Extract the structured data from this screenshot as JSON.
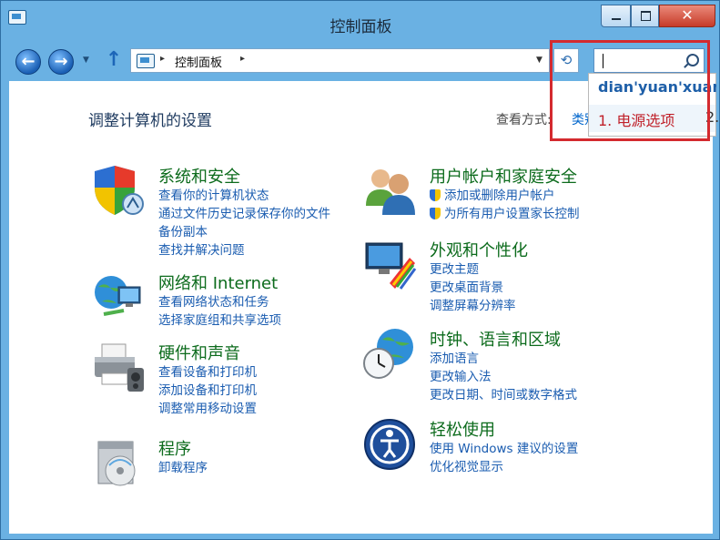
{
  "window": {
    "title": "控制面板",
    "close_glyph": "✕"
  },
  "nav": {
    "back_glyph": "←",
    "forward_glyph": "→",
    "up_glyph": "↑",
    "dropdown_glyph": "▼",
    "refresh_glyph": "⟲"
  },
  "address": {
    "path": [
      "控制面板"
    ],
    "sep_glyph": "▸"
  },
  "search": {
    "value": ""
  },
  "ime": {
    "composition": "dian'yuan'xuan",
    "candidate": "1. 电源选项",
    "next": "2."
  },
  "page": {
    "title": "调整计算机的设置",
    "view_by_label": "查看方式:",
    "view_by_value": "类别"
  },
  "categories": [
    {
      "title": "系统和安全",
      "links": [
        "查看你的计算机状态",
        "通过文件历史记录保存你的文件",
        "备份副本",
        "查找并解决问题"
      ],
      "icon": "shield-icon"
    },
    {
      "title": "网络和 Internet",
      "links": [
        "查看网络状态和任务",
        "选择家庭组和共享选项"
      ],
      "icon": "network-icon"
    },
    {
      "title": "硬件和声音",
      "links": [
        "查看设备和打印机",
        "添加设备和打印机",
        "调整常用移动设置"
      ],
      "icon": "printer-icon"
    },
    {
      "title": "程序",
      "links": [
        "卸载程序"
      ],
      "icon": "programs-icon"
    },
    {
      "title": "用户帐户和家庭安全",
      "links": [
        "添加或删除用户帐户",
        "为所有用户设置家长控制"
      ],
      "icon": "users-icon"
    },
    {
      "title": "外观和个性化",
      "links": [
        "更改主题",
        "更改桌面背景",
        "调整屏幕分辨率"
      ],
      "icon": "appearance-icon"
    },
    {
      "title": "时钟、语言和区域",
      "links": [
        "添加语言",
        "更改输入法",
        "更改日期、时间或数字格式"
      ],
      "icon": "clock-globe-icon"
    },
    {
      "title": "轻松使用",
      "links": [
        "使用 Windows 建议的设置",
        "优化视觉显示"
      ],
      "icon": "ease-of-access-icon"
    }
  ],
  "colors": {
    "frame": "#6ab1e3",
    "category_title": "#0c6b1c",
    "link": "#1a5cb0",
    "highlight": "#d42a2f"
  }
}
